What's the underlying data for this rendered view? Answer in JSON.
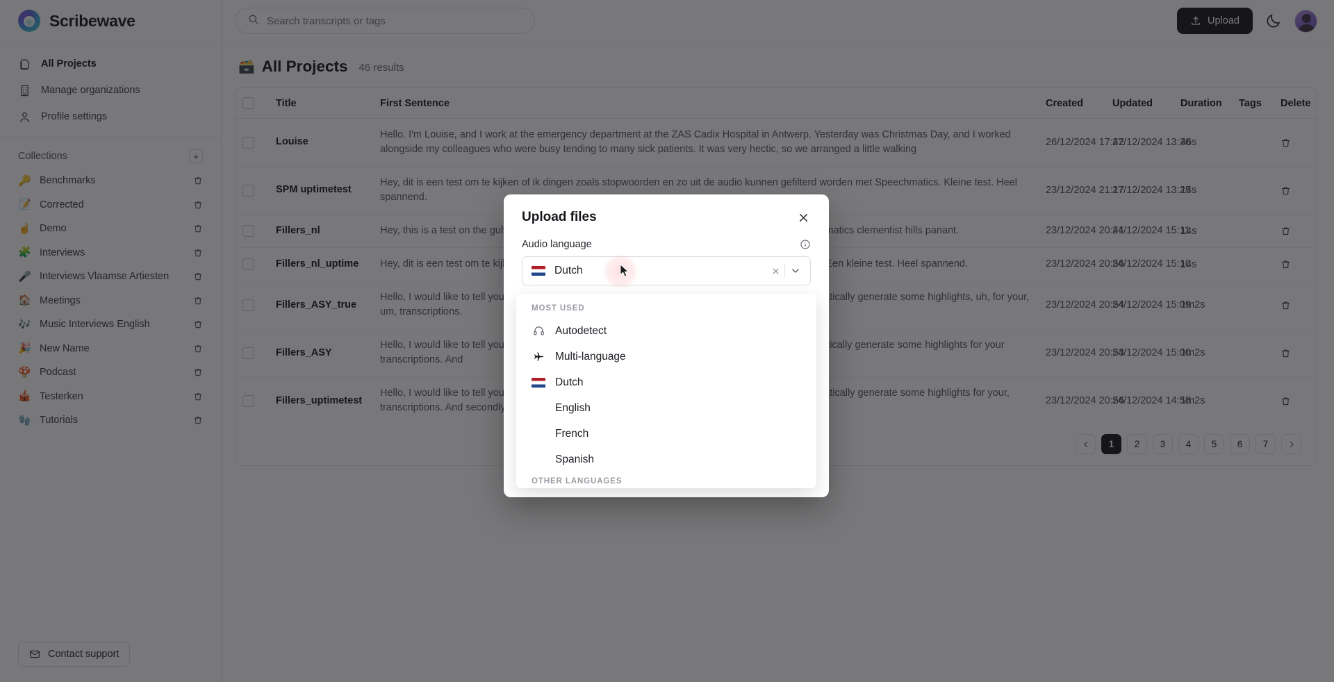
{
  "brand": {
    "name": "Scribewave",
    "logo_icon": "scribewave-logo"
  },
  "sidebar": {
    "nav": [
      {
        "label": "All Projects",
        "icon": "documents-icon",
        "active": true
      },
      {
        "label": "Manage organizations",
        "icon": "building-icon",
        "active": false
      },
      {
        "label": "Profile settings",
        "icon": "user-icon",
        "active": false
      }
    ],
    "collections_title": "Collections",
    "add_collection_label": "+",
    "collections": [
      {
        "emoji": "🔑",
        "label": "Benchmarks"
      },
      {
        "emoji": "📝",
        "label": "Corrected"
      },
      {
        "emoji": "☝️",
        "label": "Demo"
      },
      {
        "emoji": "🧩",
        "label": "Interviews"
      },
      {
        "emoji": "🎤",
        "label": "Interviews Vlaamse Artiesten"
      },
      {
        "emoji": "🏠",
        "label": "Meetings"
      },
      {
        "emoji": "🎶",
        "label": "Music Interviews English"
      },
      {
        "emoji": "🎉",
        "label": "New Name"
      },
      {
        "emoji": "🍄",
        "label": "Podcast"
      },
      {
        "emoji": "🎪",
        "label": "Testerken"
      },
      {
        "emoji": "🧤",
        "label": "Tutorials"
      }
    ],
    "support_label": "Contact support",
    "support_icon": "mail-icon"
  },
  "topbar": {
    "search_placeholder": "Search transcripts or tags",
    "search_value": "",
    "search_icon": "search-icon",
    "upload_label": "Upload",
    "upload_icon": "upload-icon",
    "theme_icon": "moon-icon",
    "avatar_name": "user-avatar"
  },
  "page": {
    "title": "All Projects",
    "title_emoji": "🗃️",
    "results": "46 results"
  },
  "table": {
    "columns": [
      "Title",
      "First Sentence",
      "Created",
      "Updated",
      "Duration",
      "Tags",
      "Delete"
    ],
    "rows": [
      {
        "title": "Louise",
        "sentence": "Hello. I'm Louise, and I work at the emergency department at the ZAS Cadix Hospital in Antwerp. Yesterday was Christmas Day, and I worked alongside my colleagues who were busy tending to many sick patients. It was very hectic, so we arranged a little walking",
        "created": "26/12/2024 17:42",
        "updated": "27/12/2024 13:26",
        "duration": "46s",
        "tags": ""
      },
      {
        "title": "SPM uptimetest",
        "sentence": "Hey, dit is een test om te kijken of ik dingen zoals stopwoorden en zo uit de audio kunnen gefilterd worden met Speechmatics. Kleine test. Heel spannend.",
        "created": "23/12/2024 21:17",
        "updated": "27/12/2024 13:25",
        "duration": "14s",
        "tags": ""
      },
      {
        "title": "Fillers_nl",
        "sentence": "Hey, this is a test on the guh, test om te kijken of ik, uh, dingen zoals stopwoorden that were speechmatics clementist hills panant.",
        "created": "23/12/2024 20:41",
        "updated": "24/12/2024 15:11",
        "duration": "14s",
        "tags": ""
      },
      {
        "title": "Fillers_nl_uptime",
        "sentence": "Hey, dit is een test om te kijken of ik dingen zoals stopwoorden gefilterd worden met Speechmatics! Een kleine test. Heel spannend.",
        "created": "23/12/2024 20:56",
        "updated": "24/12/2024 15:10",
        "duration": "14s",
        "tags": ""
      },
      {
        "title": "Fillers_ASY_true",
        "sentence": "Hello, I would like to tell you about Scribewave, a very nice, tool which allows you to highlight automatically generate some highlights, uh, for your, um, transcriptions.",
        "created": "23/12/2024 20:54",
        "updated": "24/12/2024 15:09",
        "duration": "1m2s",
        "tags": ""
      },
      {
        "title": "Fillers_ASY",
        "sentence": "Hello, I would like to tell you about Scribewave, a very nice tool which allows you to highlight automatically generate some highlights for your transcriptions. And",
        "created": "23/12/2024 20:53",
        "updated": "24/12/2024 15:00",
        "duration": "1m2s",
        "tags": ""
      },
      {
        "title": "Fillers_uptimetest",
        "sentence": "Hello, I would like to tell you about Scribewave, a very nice, tool which allows you to highlight automatically generate some highlights for your, transcriptions. And secondly, the",
        "created": "23/12/2024 20:56",
        "updated": "24/12/2024 14:58",
        "duration": "1m2s",
        "tags": ""
      }
    ],
    "delete_icon": "trash-icon"
  },
  "pagination": {
    "prev_icon": "chevron-left-icon",
    "next_icon": "chevron-right-icon",
    "pages": [
      "1",
      "2",
      "3",
      "4",
      "5",
      "6",
      "7"
    ],
    "current": "1"
  },
  "modal": {
    "title": "Upload files",
    "close_icon": "close-icon",
    "field_label": "Audio language",
    "info_icon": "info-icon",
    "selected_value": "Dutch",
    "selected_flag": "flag-nl",
    "clear_icon": "clear-icon",
    "caret_icon": "chevron-down-icon",
    "dropdown": {
      "section_most_used": "MOST USED",
      "section_other": "OTHER LANGUAGES",
      "items": [
        {
          "label": "Autodetect",
          "icon": "headphones-icon"
        },
        {
          "label": "Multi-language",
          "icon": "airplane-icon"
        },
        {
          "label": "Dutch",
          "icon": "flag-nl"
        },
        {
          "label": "English",
          "icon": ""
        },
        {
          "label": "French",
          "icon": ""
        },
        {
          "label": "Spanish",
          "icon": ""
        }
      ]
    }
  },
  "colors": {
    "accent": "#16161c",
    "ripple": "#f65c68",
    "flag_red": "#ae1c28",
    "flag_blue": "#21468b"
  }
}
